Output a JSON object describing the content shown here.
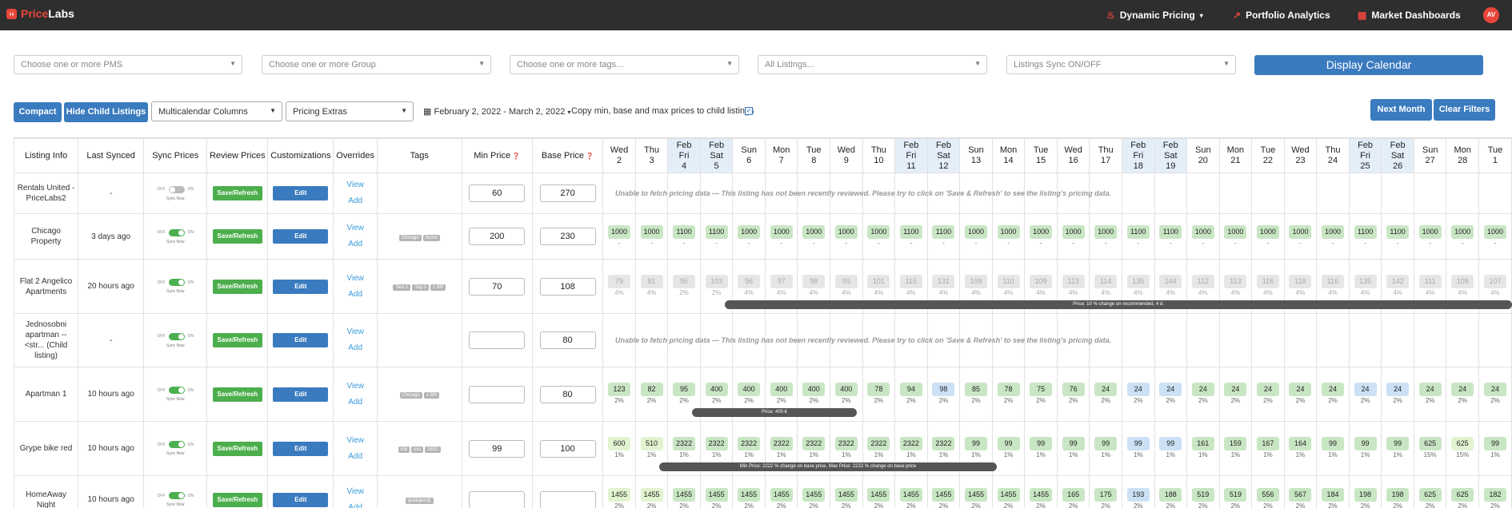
{
  "nav": {
    "logo_a": "Price",
    "logo_b": "Labs",
    "dynamic_pricing": "Dynamic Pricing",
    "portfolio_analytics": "Portfolio Analytics",
    "market_dashboards": "Market Dashboards",
    "avatar": "AV",
    "icons": [
      "flame-icon",
      "trend-icon",
      "grid-icon"
    ]
  },
  "filters": {
    "pms": "Choose one or more PMS",
    "group": "Choose one or more Group",
    "tags": "Choose one or more tags...",
    "listings": "All Listings...",
    "sync": "Listings Sync ON/OFF",
    "display": "Display Calendar"
  },
  "controls": {
    "compact": "Compact",
    "hide_child": "Hide Child Listings",
    "multical": "Multicalendar Columns",
    "extras": "Pricing Extras",
    "date_range": "February 2, 2022 - March 2, 2022",
    "copy": "Copy min, base and max prices to child listings",
    "next_month": "Next Month",
    "clear": "Clear Filters"
  },
  "columns": {
    "listing_info": "Listing Info",
    "last_synced": "Last Synced",
    "sync_prices": "Sync Prices",
    "review_prices": "Review Prices",
    "customizations": "Customizations",
    "overrides": "Overrides",
    "tags": "Tags",
    "min_price": "Min Price",
    "base_price": "Base Price"
  },
  "dates": [
    {
      "m": "",
      "d": "Wed",
      "n": "2"
    },
    {
      "m": "",
      "d": "Thu",
      "n": "3"
    },
    {
      "m": "Feb",
      "d": "Fri",
      "n": "4",
      "wk": true
    },
    {
      "m": "Feb",
      "d": "Sat",
      "n": "5",
      "wk": true
    },
    {
      "m": "",
      "d": "Sun",
      "n": "6"
    },
    {
      "m": "",
      "d": "Mon",
      "n": "7"
    },
    {
      "m": "",
      "d": "Tue",
      "n": "8"
    },
    {
      "m": "",
      "d": "Wed",
      "n": "9"
    },
    {
      "m": "",
      "d": "Thu",
      "n": "10"
    },
    {
      "m": "Feb",
      "d": "Fri",
      "n": "11",
      "wk": true
    },
    {
      "m": "Feb",
      "d": "Sat",
      "n": "12",
      "wk": true
    },
    {
      "m": "",
      "d": "Sun",
      "n": "13"
    },
    {
      "m": "",
      "d": "Mon",
      "n": "14"
    },
    {
      "m": "",
      "d": "Tue",
      "n": "15"
    },
    {
      "m": "",
      "d": "Wed",
      "n": "16"
    },
    {
      "m": "",
      "d": "Thu",
      "n": "17"
    },
    {
      "m": "Feb",
      "d": "Fri",
      "n": "18",
      "wk": true
    },
    {
      "m": "Feb",
      "d": "Sat",
      "n": "19",
      "wk": true
    },
    {
      "m": "",
      "d": "Sun",
      "n": "20"
    },
    {
      "m": "",
      "d": "Mon",
      "n": "21"
    },
    {
      "m": "",
      "d": "Tue",
      "n": "22"
    },
    {
      "m": "",
      "d": "Wed",
      "n": "23"
    },
    {
      "m": "",
      "d": "Thu",
      "n": "24"
    },
    {
      "m": "Feb",
      "d": "Fri",
      "n": "25",
      "wk": true
    },
    {
      "m": "Feb",
      "d": "Sat",
      "n": "26",
      "wk": true
    },
    {
      "m": "",
      "d": "Sun",
      "n": "27"
    },
    {
      "m": "",
      "d": "Mon",
      "n": "28"
    },
    {
      "m": "",
      "d": "Tue",
      "n": "1"
    }
  ],
  "common": {
    "view": "View",
    "add": "Add",
    "save": "Save/Refresh",
    "edit": "Edit",
    "off": "OFF",
    "on": "ON",
    "sync_now": "Sync Now",
    "no_data": "Unable to fetch pricing data  —  This listing has not been recently reviewed. Please try to click on 'Save & Refresh' to see the listing's pricing data."
  },
  "rows": [
    {
      "name": "Rentals United - PriceLabs2",
      "synced": "-",
      "on": false,
      "tags": [],
      "min": "60",
      "base": "270",
      "nodata": true
    },
    {
      "name": "Chicago Property",
      "synced": "3 days ago",
      "on": true,
      "tags": [
        "Chicago",
        "home"
      ],
      "min": "200",
      "base": "230",
      "prices": [
        "1000",
        "1000",
        "1100",
        "1100",
        "1000",
        "1000",
        "1000",
        "1000",
        "1000",
        "1100",
        "1100",
        "1000",
        "1000",
        "1000",
        "1000",
        "1000",
        "1100",
        "1100",
        "1000",
        "1000",
        "1000",
        "1000",
        "1000",
        "1100",
        "1100",
        "1000",
        "1000",
        "1000"
      ],
      "subs": [
        "-",
        "-",
        "-",
        "-",
        "-",
        "-",
        "-",
        "-",
        "-",
        "-",
        "-",
        "-",
        "-",
        "-",
        "-",
        "-",
        "-",
        "-",
        "-",
        "-",
        "-",
        "-",
        "-",
        "-",
        "-",
        "-",
        "-",
        "-"
      ],
      "style": "g"
    },
    {
      "name": "Flat 2 Angelico Apartments",
      "synced": "20 hours ago",
      "on": true,
      "tags": [
        "Test 1",
        "Tag 2",
        "1 BR"
      ],
      "min": "70",
      "base": "108",
      "prices": [
        "79",
        "81",
        "95",
        "103",
        "96",
        "97",
        "98",
        "99",
        "101",
        "115",
        "131",
        "109",
        "110",
        "109",
        "113",
        "114",
        "135",
        "144",
        "112",
        "113",
        "116",
        "118",
        "116",
        "135",
        "142",
        "111",
        "109",
        "107"
      ],
      "subs": [
        "4%",
        "4%",
        "2%",
        "2%",
        "4%",
        "4%",
        "4%",
        "4%",
        "4%",
        "4%",
        "4%",
        "4%",
        "4%",
        "4%",
        "4%",
        "4%",
        "4%",
        "4%",
        "4%",
        "4%",
        "4%",
        "4%",
        "4%",
        "4%",
        "4%",
        "4%",
        "4%",
        "4%"
      ],
      "style": "gr",
      "bar": "Price: 10 % change on recommended, 4 d."
    },
    {
      "name": "Jednosobni apartman -- <str... (Child listing)",
      "synced": "-",
      "on": true,
      "tags": [],
      "min": "",
      "base": "80",
      "nodata": true
    },
    {
      "name": "Apartman 1",
      "synced": "10 hours ago",
      "on": true,
      "tags": [
        "Chicago",
        "1 BR"
      ],
      "min": "",
      "base": "80",
      "prices": [
        "123",
        "82",
        "95",
        "400",
        "400",
        "400",
        "400",
        "400",
        "78",
        "94",
        "98",
        "85",
        "78",
        "75",
        "76",
        "24",
        "24",
        "24",
        "24",
        "24",
        "24",
        "24",
        "24",
        "24",
        "24",
        "24",
        "24",
        "24"
      ],
      "subs": [
        "2%",
        "2%",
        "2%",
        "2%",
        "2%",
        "2%",
        "2%",
        "2%",
        "2%",
        "2%",
        "2%",
        "2%",
        "2%",
        "2%",
        "2%",
        "2%",
        "2%",
        "2%",
        "2%",
        "2%",
        "2%",
        "2%",
        "2%",
        "2%",
        "2%",
        "2%",
        "2%",
        "2%"
      ],
      "blue": [
        10,
        16,
        17,
        23,
        24
      ],
      "style": "g",
      "bar": "Price: 400 €"
    },
    {
      "name": "Grype bike red",
      "synced": "10 hours ago",
      "on": true,
      "tags": [
        "Kik",
        "sss",
        "1810"
      ],
      "min": "99",
      "base": "100",
      "prices": [
        "600",
        "510",
        "2322",
        "2322",
        "2322",
        "2322",
        "2322",
        "2322",
        "2322",
        "2322",
        "2322",
        "99",
        "99",
        "99",
        "99",
        "99",
        "99",
        "99",
        "161",
        "159",
        "167",
        "164",
        "99",
        "99",
        "99",
        "625",
        "625",
        "99"
      ],
      "subs": [
        "1%",
        "1%",
        "1%",
        "1%",
        "1%",
        "1%",
        "1%",
        "1%",
        "1%",
        "1%",
        "1%",
        "1%",
        "1%",
        "1%",
        "1%",
        "1%",
        "1%",
        "1%",
        "1%",
        "1%",
        "1%",
        "1%",
        "1%",
        "1%",
        "1%",
        "15%",
        "15%",
        "1%"
      ],
      "blue": [
        16,
        17
      ],
      "light": [
        0,
        1,
        26
      ],
      "style": "g",
      "bar": "Min Price: 2222 % change on base price, Max Price: 2222 % change on base price"
    },
    {
      "name": "HomeAway Night",
      "synced": "10 hours ago",
      "on": true,
      "tags": [
        "guékgeir@"
      ],
      "min": "",
      "base": "",
      "prices": [
        "1455",
        "1455",
        "1455",
        "1455",
        "1455",
        "1455",
        "1455",
        "1455",
        "1455",
        "1455",
        "1455",
        "1455",
        "1455",
        "1455",
        "165",
        "175",
        "193",
        "188",
        "519",
        "519",
        "556",
        "567",
        "184",
        "198",
        "198",
        "625",
        "625",
        "182"
      ],
      "subs": [
        "2%",
        "2%",
        "2%",
        "2%",
        "2%",
        "2%",
        "2%",
        "2%",
        "2%",
        "2%",
        "2%",
        "2%",
        "2%",
        "2%",
        "2%",
        "2%",
        "2%",
        "2%",
        "2%",
        "2%",
        "2%",
        "2%",
        "2%",
        "2%",
        "2%",
        "2%",
        "2%",
        "2%"
      ],
      "blue": [
        16
      ],
      "light": [
        0,
        1
      ],
      "style": "g"
    }
  ]
}
